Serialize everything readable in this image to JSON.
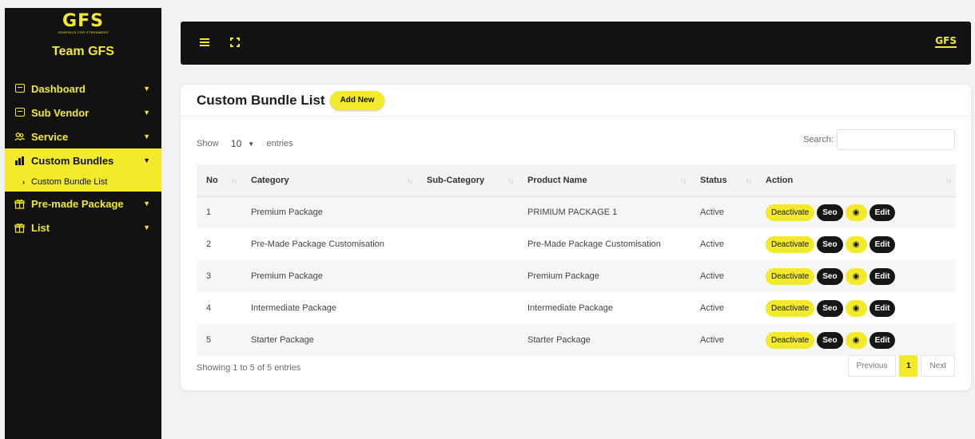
{
  "brand": {
    "logo": "GFS",
    "tagline": "GRAPHICS FOR STREAMERS",
    "team": "Team GFS"
  },
  "sidebar": {
    "items": [
      {
        "label": "Dashboard",
        "icon": "window-icon"
      },
      {
        "label": "Sub Vendor",
        "icon": "window-icon"
      },
      {
        "label": "Service",
        "icon": "users-icon"
      },
      {
        "label": "Custom Bundles",
        "icon": "bundle-icon",
        "active": true
      },
      {
        "label": "Pre-made Package",
        "icon": "gift-icon"
      },
      {
        "label": "List",
        "icon": "gift-icon"
      }
    ],
    "sub_item": "Custom Bundle List"
  },
  "topbar": {
    "logo": "GFS"
  },
  "page": {
    "title": "Custom Bundle List",
    "add_new_label": "Add New",
    "show_label": "Show",
    "entries_label": "entries",
    "page_length": "10",
    "search_label": "Search:",
    "search_value": ""
  },
  "table": {
    "columns": [
      "No",
      "Category",
      "Sub-Category",
      "Product Name",
      "Status",
      "Action"
    ],
    "rows": [
      {
        "no": "1",
        "category": "Premium Package",
        "subcategory": "",
        "product": "PRIMIUM PACKAGE 1",
        "status": "Active"
      },
      {
        "no": "2",
        "category": "Pre-Made Package Customisation",
        "subcategory": "",
        "product": "Pre-Made Package Customisation",
        "status": "Active"
      },
      {
        "no": "3",
        "category": "Premium Package",
        "subcategory": "",
        "product": "Premium Package",
        "status": "Active"
      },
      {
        "no": "4",
        "category": "Intermediate Package",
        "subcategory": "",
        "product": "Intermediate Package",
        "status": "Active"
      },
      {
        "no": "5",
        "category": "Starter Package",
        "subcategory": "",
        "product": "Starter Package",
        "status": "Active"
      }
    ],
    "actions": {
      "deactivate": "Deactivate",
      "seo": "Seo",
      "view_icon": "eye-icon",
      "edit": "Edit"
    }
  },
  "footer": {
    "info": "Showing 1 to 5 of 5 entries",
    "previous": "Previous",
    "current_page": "1",
    "next": "Next"
  },
  "colors": {
    "accent": "#f2ea2b",
    "dark": "#121212",
    "background": "#f1f2f4"
  }
}
